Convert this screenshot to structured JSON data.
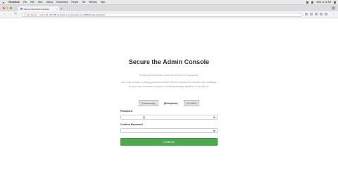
{
  "menubar": {
    "app": "Chromium",
    "items": [
      "File",
      "Edit",
      "View",
      "History",
      "Bookmarks",
      "People",
      "Tab",
      "Window",
      "Help"
    ],
    "clock": "Wed 11:21 AM"
  },
  "tab": {
    "title": "Secure the Admin Console"
  },
  "address": {
    "insecure_label": "Not Secure",
    "url": "ec2-3-91-134-198.compute-1.amazonaws.com:8080/create-password"
  },
  "page": {
    "title": "Secure the Admin Console",
    "subtitle": "Keeping the admin console secure is important.",
    "description": "You can create a strong password that will be required to access the settings, or you can connect it to your existing identity system to protect it.",
    "strength_buttons": [
      "(Community)",
      "(Enterprise)",
      "(CLOUD)"
    ],
    "password_label": "Password",
    "confirm_label": "Confirm Password",
    "continue_label": "Continue"
  },
  "colors": {
    "continue": "#4ea84e",
    "insecure": "#c0392b"
  }
}
